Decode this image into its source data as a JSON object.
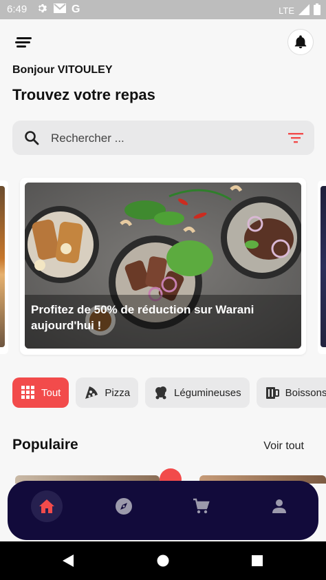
{
  "status_bar": {
    "time": "6:49",
    "network": "LTE",
    "icons": [
      "settings-icon",
      "gmail-icon",
      "google-icon",
      "signal-icon",
      "battery-icon"
    ]
  },
  "header": {
    "menu_icon": "menu-icon",
    "bell_icon": "bell-icon"
  },
  "greeting": "Bonjour VITOULEY",
  "title": "Trouvez votre repas",
  "search": {
    "placeholder": "Rechercher ...",
    "icon": "search-icon",
    "filter_icon": "filter-icon"
  },
  "promo": {
    "text": "Profitez de 50% de réduction sur Warani aujourd'hui !"
  },
  "categories": [
    {
      "label": "Tout",
      "icon": "grid-icon",
      "active": true
    },
    {
      "label": "Pizza",
      "icon": "pizza-icon",
      "active": false
    },
    {
      "label": "Légumineuses",
      "icon": "legumes-icon",
      "active": false
    },
    {
      "label": "Boissons",
      "icon": "drink-icon",
      "active": false
    }
  ],
  "popular": {
    "title": "Populaire",
    "see_all": "Voir tout"
  },
  "bottom_nav": [
    {
      "name": "home",
      "icon": "home-icon",
      "active": true
    },
    {
      "name": "explore",
      "icon": "compass-icon",
      "active": false
    },
    {
      "name": "cart",
      "icon": "cart-icon",
      "active": false
    },
    {
      "name": "profile",
      "icon": "person-icon",
      "active": false
    }
  ],
  "colors": {
    "accent": "#f24b4b",
    "navbar": "#120b3b",
    "chip_bg": "#e9e9ea"
  }
}
